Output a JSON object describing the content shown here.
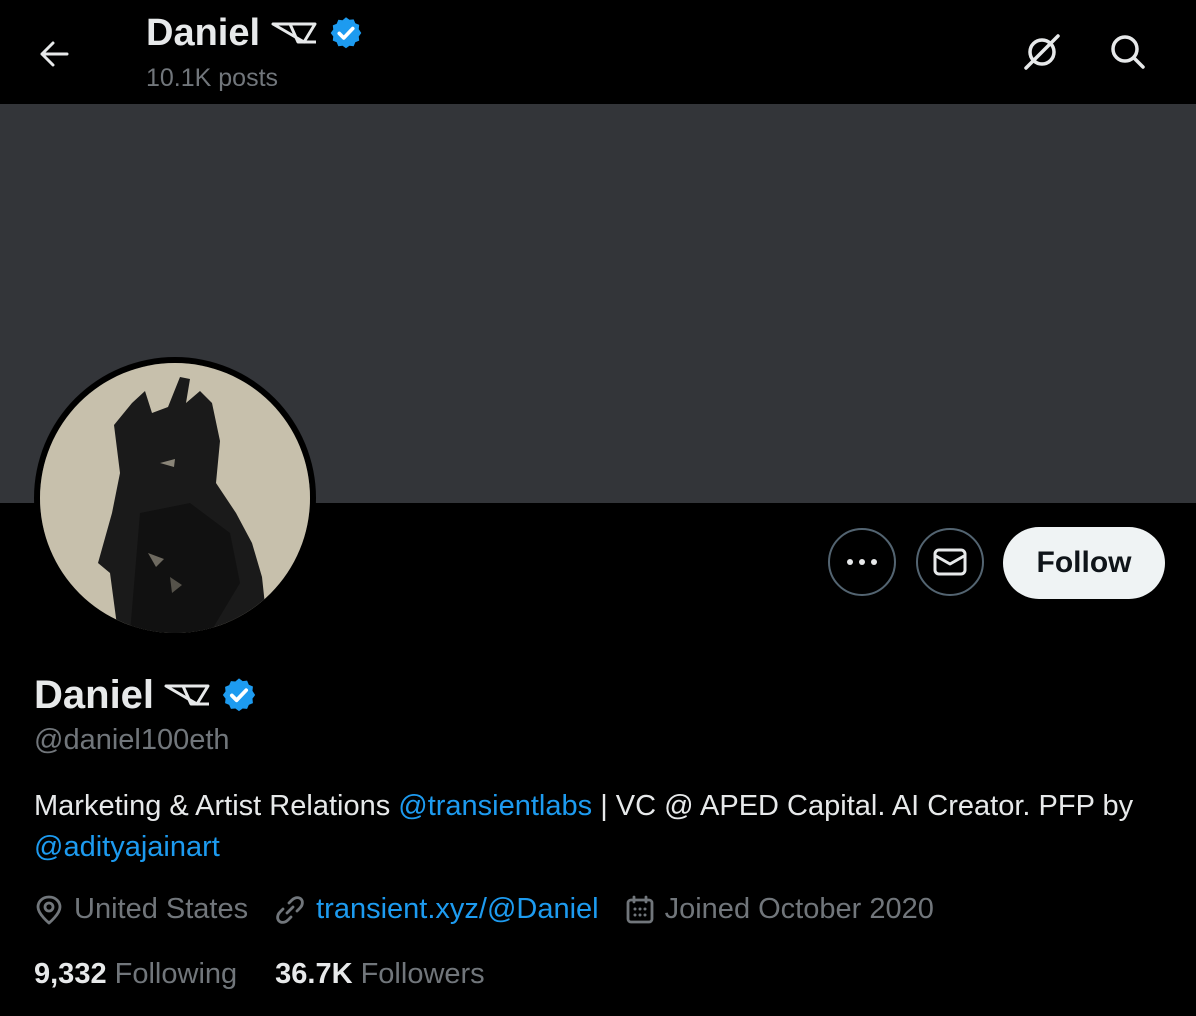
{
  "header": {
    "name": "Daniel",
    "posts_count": "10.1K posts"
  },
  "profile": {
    "display_name": "Daniel",
    "handle": "@daniel100eth",
    "bio": {
      "part1": "Marketing & Artist Relations ",
      "mention1": "@transientlabs",
      "part2": " | VC @ APED Capital. AI Creator. PFP by ",
      "mention2": "@adityajainart"
    },
    "location": "United States",
    "website": "transient.xyz/@Daniel",
    "joined": "Joined October 2020",
    "following_count": "9,332",
    "following_label": "Following",
    "followers_count": "36.7K",
    "followers_label": "Followers"
  },
  "actions": {
    "follow_label": "Follow"
  },
  "icons": {
    "back": "back-arrow-icon",
    "grok": "grok-icon",
    "search": "search-icon",
    "more": "more-icon",
    "message": "envelope-icon",
    "verified": "verified-badge-icon",
    "location": "location-pin-icon",
    "link": "link-icon",
    "calendar": "calendar-icon"
  },
  "colors": {
    "background": "#000000",
    "banner": "#333539",
    "accent": "#1d9bf0",
    "secondary_text": "#71767b",
    "primary_text": "#e7e9ea"
  }
}
